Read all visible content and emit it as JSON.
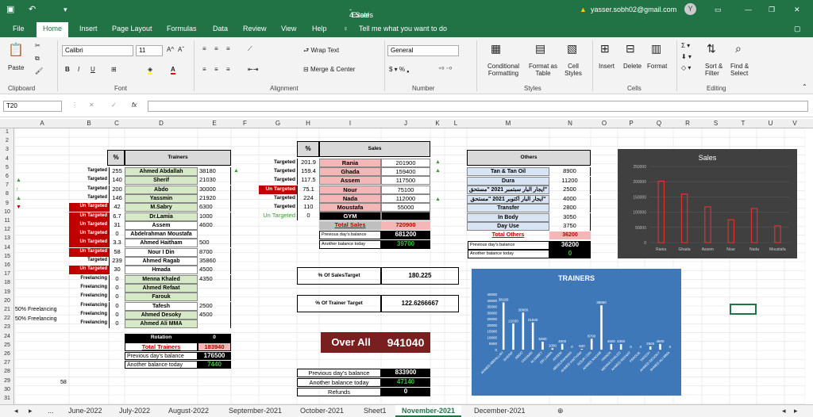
{
  "title": {
    "file": "4.Sales & Trainers - 2022.xlsx",
    "app": "Excel",
    "user": "yasser.sobh02@gmail.com",
    "avatar": "Y"
  },
  "tabs": [
    "File",
    "Home",
    "Insert",
    "Page Layout",
    "Formulas",
    "Data",
    "Review",
    "View",
    "Help"
  ],
  "tell_me": "Tell me what you want to do",
  "ribbon": {
    "font_name": "Calibri",
    "font_size": "11",
    "wrap_text": "Wrap Text",
    "merge": "Merge & Center",
    "number_format": "General",
    "paste": "Paste",
    "cond_fmt": "Conditional Formatting",
    "fmt_table": "Format as Table",
    "cell_styles": "Cell Styles",
    "insert": "Insert",
    "delete": "Delete",
    "format": "Format",
    "sort_filter": "Sort & Filter",
    "find_select": "Find & Select",
    "groups": [
      "Clipboard",
      "Font",
      "Alignment",
      "Number",
      "Styles",
      "Cells",
      "Editing"
    ]
  },
  "namebox": "T20",
  "columns": [
    "A",
    "B",
    "C",
    "D",
    "E",
    "F",
    "G",
    "H",
    "I",
    "J",
    "K",
    "L",
    "M",
    "N",
    "O",
    "P",
    "Q",
    "R",
    "S",
    "T",
    "U",
    "V"
  ],
  "trainers": {
    "header": "Trainers",
    "pct": "%",
    "rows": [
      [
        "Targeted",
        "255",
        "Ahmed Abdallah",
        "38180"
      ],
      [
        "Targeted",
        "140",
        "Sherif",
        "21030"
      ],
      [
        "Targeted",
        "200",
        "Abdo",
        "30000"
      ],
      [
        "Targeted",
        "146",
        "Yassmin",
        "21920"
      ],
      [
        "Un Targeted",
        "42",
        "M.Sabry",
        "6300"
      ],
      [
        "Un Targeted",
        "6.7",
        "Dr.Lamia",
        "1000"
      ],
      [
        "Un Targeted",
        "31",
        "Assem",
        "4600"
      ],
      [
        "Un Targeted",
        "0",
        "Abdelrahman Moustafa",
        ""
      ],
      [
        "Un Targeted",
        "3.3",
        "Ahmed Haitham",
        "500"
      ],
      [
        "Un Targeted",
        "58",
        "Nour I Din",
        "8700"
      ],
      [
        "Targeted",
        "239",
        "Ahmed Ragab",
        "35860"
      ],
      [
        "Un Targeted",
        "30",
        "Hmada",
        "4500"
      ],
      [
        "Freelancing",
        "0",
        "Menna Khaled",
        "4350"
      ],
      [
        "Freelancing",
        "0",
        "Ahmed Refaat",
        ""
      ],
      [
        "Freelancing",
        "0",
        "Farouk",
        ""
      ],
      [
        "Freelancing",
        "0",
        "Tafesh",
        "2500"
      ],
      [
        "Freelancing",
        "0",
        "Ahmed Desoky",
        "4500"
      ],
      [
        "Freelancing",
        "0",
        "Ahmed Ali MMA",
        ""
      ]
    ],
    "rotation": "Rotation",
    "rotation_val": "0",
    "total_label": "Total Trainers",
    "total_val": "183940",
    "prev_label": "Previous day's balance",
    "prev_val": "176500",
    "another_label": "Another balance today",
    "another_val": "7440"
  },
  "a_col": {
    "r20": "50% Freelancing",
    "r21": "50% Freelancing",
    "b28": "58"
  },
  "sales": {
    "header": "Sales",
    "pct": "%",
    "rows": [
      [
        "Targeted",
        "201.9",
        "Rania",
        "201900"
      ],
      [
        "Targeted",
        "159.4",
        "Ghada",
        "159400"
      ],
      [
        "Targeted",
        "117.5",
        "Assem",
        "117500"
      ],
      [
        "Un Targeted",
        "75.1",
        "Nour",
        "75100"
      ],
      [
        "Targeted",
        "224",
        "Nada",
        "112000"
      ],
      [
        "Targeted",
        "110",
        "Moustafa",
        "55000"
      ],
      [
        "Un Targeted",
        "0",
        "GYM",
        ""
      ]
    ],
    "total_label": "Total Sales",
    "total_val": "720900",
    "prev_label": "Previous day's balance",
    "prev_val": "681200",
    "another_label": "Another balance today",
    "another_val": "39700"
  },
  "others": {
    "header": "Others",
    "rows": [
      [
        "Tan & Tan Oil",
        "8900"
      ],
      [
        "Dura",
        "11200"
      ],
      [
        "ايجار البار سبتمبر 2021 \"مستحق\"",
        "2500"
      ],
      [
        "ايجار البار اكتوبر 2021 \"مستحق\"",
        "4000"
      ],
      [
        "Transfer",
        "2800"
      ],
      [
        "In Body",
        "3050"
      ],
      [
        "Day Use",
        "3750"
      ]
    ],
    "total_label": "Total Others",
    "total_val": "36200",
    "prev_label": "Previous day's balance",
    "prev_val": "36200",
    "another_label": "Another balance today",
    "another_val": "0"
  },
  "pct_sales": {
    "label": "% Of SalesTarget",
    "value": "180.225"
  },
  "pct_trainer": {
    "label": "% Of Trainer Target",
    "value": "122.6266667"
  },
  "over_all": {
    "label": "Over All",
    "value": "941040"
  },
  "bottom": {
    "prev_label": "Previous day's balance",
    "prev_val": "833900",
    "another_label": "Another balance today",
    "another_val": "47140",
    "refunds_label": "Refunds",
    "refunds_val": "0"
  },
  "sheets": [
    "...",
    "June-2022",
    "July-2022",
    "August-2022",
    "September-2021",
    "October-2021",
    "Sheet1",
    "November-2021",
    "December-2021"
  ],
  "active_sheet": "November-2021",
  "chart_data": [
    {
      "type": "bar",
      "title": "Sales",
      "categories": [
        "Rania",
        "Ghada",
        "Assem",
        "Nour",
        "Nada",
        "Moustafa"
      ],
      "values": [
        201900,
        159400,
        117500,
        75100,
        112000,
        55000
      ],
      "ylim": [
        0,
        250000
      ],
      "yticks": [
        "250000",
        "200000",
        "150000",
        "100000",
        "50000",
        "0"
      ]
    },
    {
      "type": "bar",
      "title": "TRAINERS",
      "categories": [
        "AHMED ABDALLAH",
        "SHERIF",
        "ABDO",
        "YASSMIN",
        "M.SABRY",
        "DR.LAMIA",
        "ASSEM",
        "ABDELRAHMAN",
        "AHMED HAITHAM",
        "NOUR I DIN",
        "AHMED RAGAB",
        "HMADA",
        "MENNA KHALED",
        "AHMED REFAAT",
        "FAROUK",
        "TAFESH",
        "AHMED DESOKY",
        "AHMED ALI MMA"
      ],
      "values": [
        38180,
        21030,
        30000,
        21920,
        6300,
        1000,
        4600,
        0,
        500,
        8700,
        35860,
        4500,
        4350,
        0,
        0,
        2500,
        4500,
        0
      ],
      "labels": [
        "38180",
        "21030",
        "30000",
        "21920",
        "6300",
        "1000",
        "4600",
        "0",
        "500",
        "8700",
        "35860",
        "4500",
        "4350",
        "0",
        "0",
        "2500",
        "4500",
        "0"
      ],
      "ylim": [
        0,
        45000
      ],
      "yticks": [
        "45000",
        "40000",
        "35000",
        "30000",
        "25000",
        "20000",
        "15000",
        "10000",
        "5000",
        "0"
      ]
    }
  ],
  "colors": {
    "excel_green": "#217346",
    "targeted_green": "#3a9c3a",
    "untargeted_red": "#c00000",
    "grid": "#d4d4d4"
  }
}
